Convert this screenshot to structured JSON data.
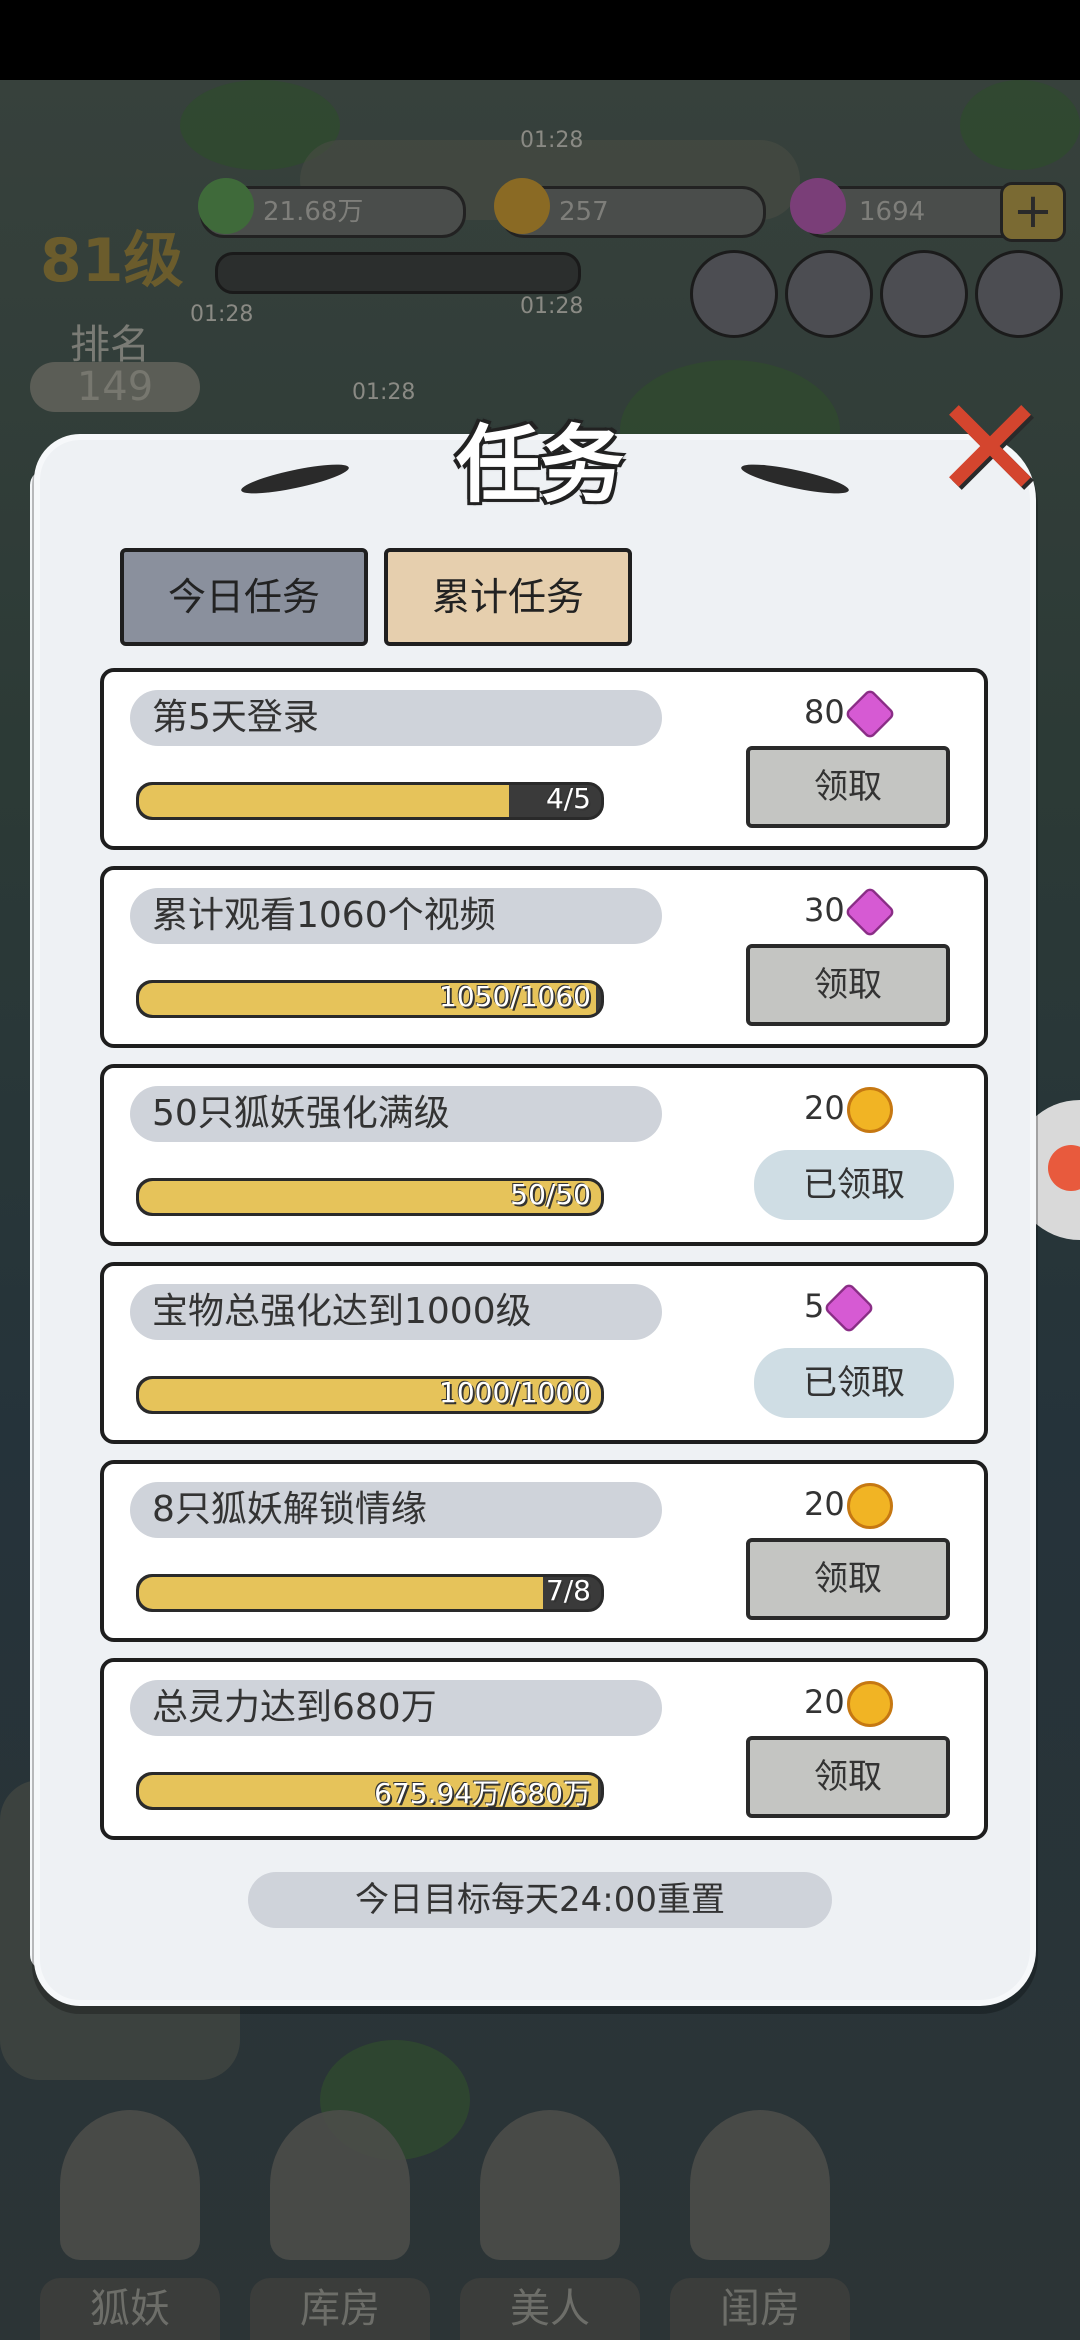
{
  "hud": {
    "currency1": "21.68万",
    "currency2": "257",
    "currency3": "1694",
    "plus": "+",
    "level": "81级",
    "rank_label": "排名",
    "rank_value": "149",
    "timer1": "01:28",
    "timer2": "01:28",
    "timer3": "01:28",
    "timer4": "01:28"
  },
  "modal": {
    "title": "任务",
    "close": "✕",
    "tabs": [
      {
        "label": "今日任务"
      },
      {
        "label": "累计任务"
      }
    ],
    "tasks": [
      {
        "name": "第5天登录",
        "progress_text": "4/5",
        "progress": 0.8,
        "reward_amount": "80",
        "reward_icon": "gem-icon",
        "button": "领取",
        "status": "claim"
      },
      {
        "name": "累计观看1060个视频",
        "progress_text": "1050/1060",
        "progress": 0.99,
        "reward_amount": "30",
        "reward_icon": "gem-icon",
        "button": "领取",
        "status": "claim"
      },
      {
        "name": "50只狐妖强化满级",
        "progress_text": "50/50",
        "progress": 1.0,
        "reward_amount": "20",
        "reward_icon": "coin-icon",
        "button": "已领取",
        "status": "claimed"
      },
      {
        "name": "宝物总强化达到1000级",
        "progress_text": "1000/1000",
        "progress": 1.0,
        "reward_amount": "5",
        "reward_icon": "gem-icon",
        "button": "已领取",
        "status": "claimed"
      },
      {
        "name": "8只狐妖解锁情缘",
        "progress_text": "7/8",
        "progress": 0.875,
        "reward_amount": "20",
        "reward_icon": "coin-icon",
        "button": "领取",
        "status": "claim"
      },
      {
        "name": "总灵力达到680万",
        "progress_text": "675.94万/680万",
        "progress": 0.994,
        "reward_amount": "20",
        "reward_icon": "coin-icon",
        "button": "领取",
        "status": "claim"
      }
    ],
    "footer_note": "今日目标每天24:00重置"
  },
  "nav": [
    {
      "label": "狐妖"
    },
    {
      "label": "库房"
    },
    {
      "label": "美人"
    },
    {
      "label": "闺房"
    }
  ],
  "colors": {
    "progress_fill": "#e6c35a",
    "tab_active": "#e6cfae",
    "tab_inactive": "#8a909d",
    "close_red": "#d4452e"
  }
}
